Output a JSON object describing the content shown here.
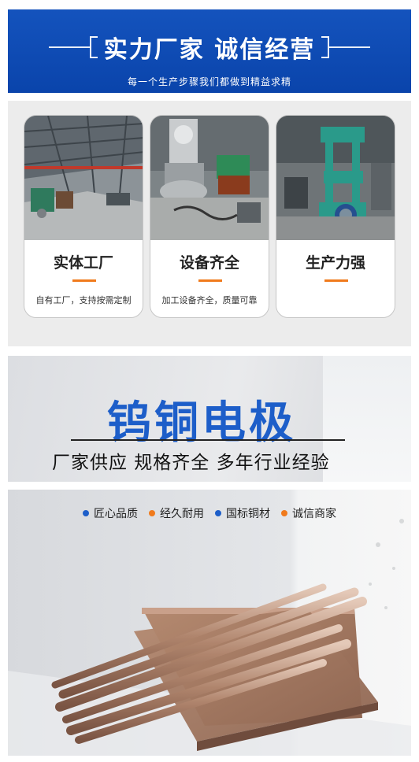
{
  "banner": {
    "title": "实力厂家 诚信经营",
    "subtitle": "每一个生产步骤我们都做到精益求精",
    "color": "#0f4cb5"
  },
  "features": [
    {
      "title": "实体工厂",
      "desc": "自有工厂，支持按需定制",
      "image": "factory-floor"
    },
    {
      "title": "设备齐全",
      "desc": "加工设备齐全，质量可靠",
      "image": "processing-equipment"
    },
    {
      "title": "生产力强",
      "desc": "",
      "image": "hydraulic-press"
    }
  ],
  "product": {
    "title": "钨铜电极",
    "subtitle": "厂家供应  规格齐全  多年行业经验",
    "title_color": "#1d5ec9"
  },
  "badges": [
    {
      "label": "匠心品质",
      "color": "#1d5ec9"
    },
    {
      "label": "经久耐用",
      "color": "#f07a1c"
    },
    {
      "label": "国标铜材",
      "color": "#1d5ec9"
    },
    {
      "label": "诚信商家",
      "color": "#f07a1c"
    }
  ],
  "accent": "#f07a1c"
}
